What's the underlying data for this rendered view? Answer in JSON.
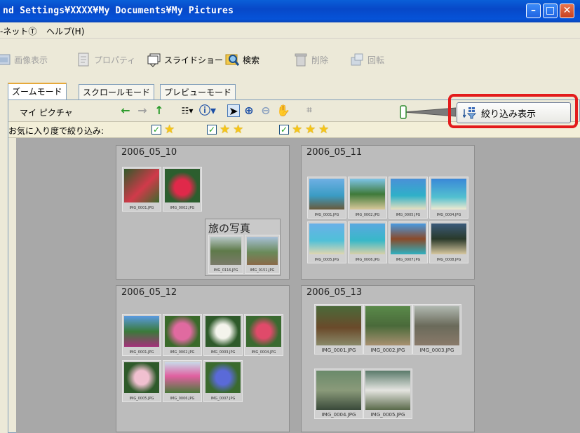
{
  "window": {
    "title": "nd Settings¥XXXX¥My Documents¥My Pictures",
    "buttons": {
      "minimize": "–",
      "maximize": "□",
      "close": "✕"
    }
  },
  "menu": {
    "items": [
      "-ネットⓉ",
      "ヘルプ(H)"
    ]
  },
  "toolbar": {
    "items": [
      {
        "label": "画像表示",
        "icon": "image-view-icon",
        "enabled": false
      },
      {
        "label": "プロパティ",
        "icon": "properties-icon",
        "enabled": false
      },
      {
        "label": "スライドショー",
        "icon": "slideshow-icon",
        "enabled": true
      },
      {
        "label": "検索",
        "icon": "search-icon",
        "enabled": true
      },
      {
        "label": "削除",
        "icon": "trash-icon",
        "enabled": false
      },
      {
        "label": "回転",
        "icon": "rotate-icon",
        "enabled": false
      }
    ]
  },
  "tabs": [
    "ズームモード",
    "スクロールモード",
    "プレビューモード"
  ],
  "nav": {
    "folder_label": "マイ ピクチャ",
    "filter_button_label": "絞り込み表示"
  },
  "filter": {
    "label": "お気に入り度で絞り込み:",
    "options": [
      {
        "checked": true,
        "stars": 1
      },
      {
        "checked": true,
        "stars": 2
      },
      {
        "checked": true,
        "stars": 3
      }
    ]
  },
  "groups": [
    {
      "title": "2006_05_10",
      "thumbs": [
        "IMG_0001.JPG",
        "IMG_0002.JPG"
      ],
      "subgroup": {
        "title": "旅の写真",
        "thumbs": [
          "IMG_0116.JPG",
          "IMG_0151.JPG"
        ]
      }
    },
    {
      "title": "2006_05_11",
      "thumbs": [
        "IMG_0001.JPG",
        "IMG_0002.JPG",
        "IMG_0005.JPG",
        "IMG_0004.JPG",
        "IMG_0005.JPG",
        "IMG_0006.JPG",
        "IMG_0007.JPG",
        "IMG_0008.JPG"
      ]
    },
    {
      "title": "2006_05_12",
      "thumbs": [
        "IMG_0001.JPG",
        "IMG_0002.JPG",
        "IMG_0003.JPG",
        "IMG_0004.JPG",
        "IMG_0005.JPG",
        "IMG_0006.JPG",
        "IMG_0007.JPG"
      ]
    },
    {
      "title": "2006_05_13",
      "thumbs": [
        "IMG_0001.JPG",
        "IMG_0002.JPG",
        "IMG_0003.JPG",
        "IMG_0004.JPG",
        "IMG_0005.JPG"
      ]
    }
  ],
  "colors": {
    "titlebar": "#0748c8",
    "highlight": "#e31b1b",
    "content_bg": "#a8a8a8",
    "group_bg": "#bcbcbc"
  }
}
